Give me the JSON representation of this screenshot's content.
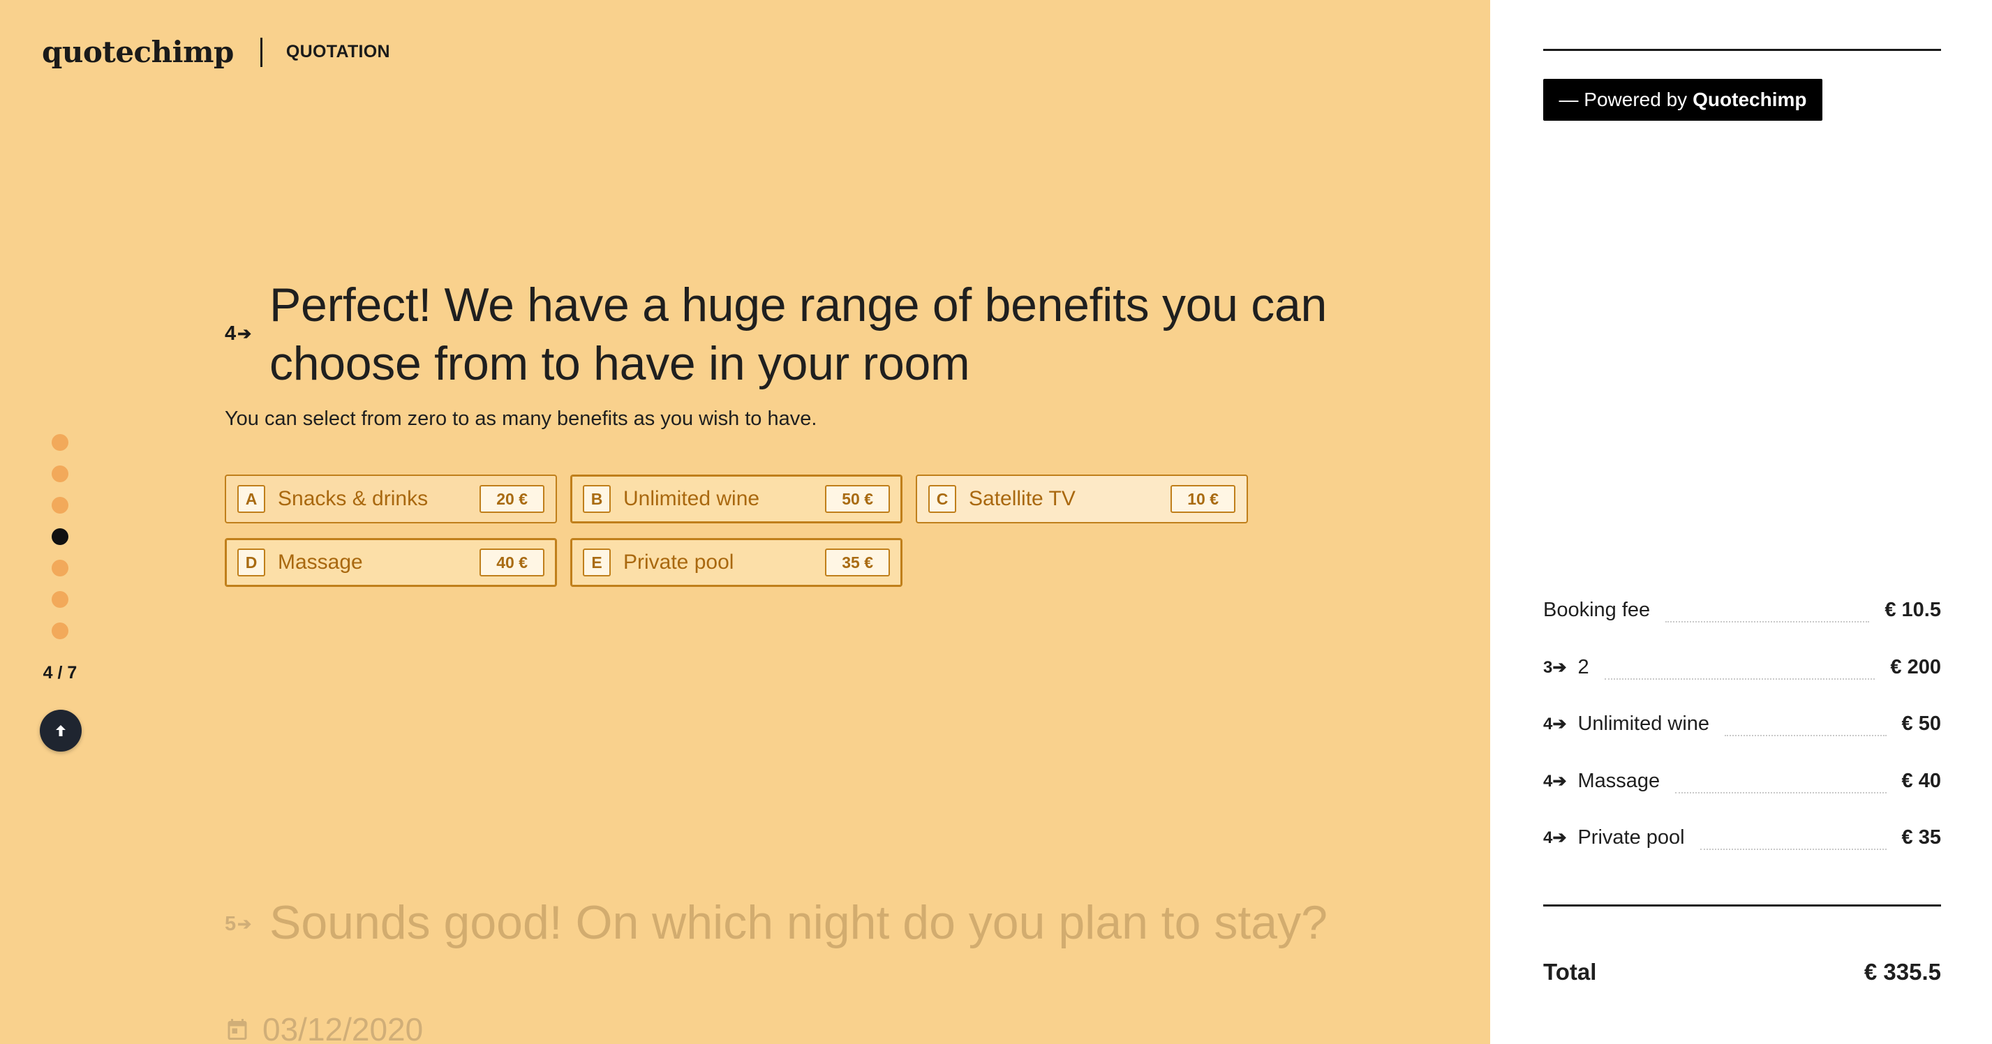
{
  "header": {
    "logo": "quotechimp",
    "section": "QUOTATION"
  },
  "progress": {
    "steps_total": 7,
    "current_step": 4,
    "label": "4 / 7"
  },
  "question": {
    "number": "4",
    "title": "Perfect! We have a huge range of benefits you can choose from to have in your room",
    "description": "You can select from zero to as many benefits as you wish to have.",
    "options": [
      {
        "key": "A",
        "label": "Snacks & drinks",
        "price": "20 €",
        "selected": false
      },
      {
        "key": "B",
        "label": "Unlimited wine",
        "price": "50 €",
        "selected": true
      },
      {
        "key": "C",
        "label": "Satellite TV",
        "price": "10 €",
        "selected": false
      },
      {
        "key": "D",
        "label": "Massage",
        "price": "40 €",
        "selected": true
      },
      {
        "key": "E",
        "label": "Private pool",
        "price": "35 €",
        "selected": true
      }
    ]
  },
  "next_question": {
    "number": "5",
    "title": "Sounds good! On which night do you plan to stay?",
    "date_value": "03/12/2020"
  },
  "sidebar": {
    "powered_prefix": "— Powered by",
    "powered_brand": "Quotechimp",
    "rows": [
      {
        "step": "",
        "label": "Booking fee",
        "value": "€ 10.5"
      },
      {
        "step": "3",
        "label": "2",
        "value": "€ 200"
      },
      {
        "step": "4",
        "label": "Unlimited wine",
        "value": "€ 50"
      },
      {
        "step": "4",
        "label": "Massage",
        "value": "€ 40"
      },
      {
        "step": "4",
        "label": "Private pool",
        "value": "€ 35"
      }
    ],
    "total_label": "Total",
    "total_value": "€ 335.5"
  },
  "colors": {
    "background": "#f9d18d",
    "accent": "#c07f1b",
    "dot": "#f2a95a",
    "dark": "#1f2530"
  }
}
